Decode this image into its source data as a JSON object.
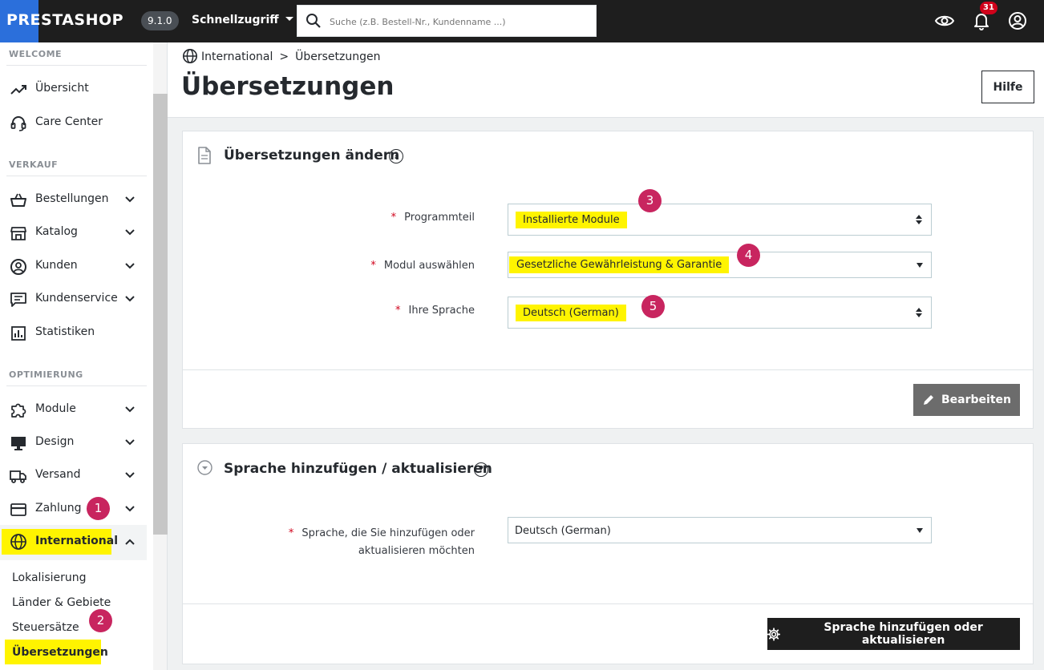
{
  "header": {
    "logo_text": "PRESTASHOP",
    "version": "9.1.0",
    "quick_access": "Schnellzugriff",
    "search_placeholder": "Suche (z.B. Bestell-Nr., Kundenname ...)",
    "notification_count": "31",
    "icons": [
      "eye-icon",
      "bell-icon",
      "account-icon"
    ]
  },
  "sidebar": {
    "sections": {
      "welcome": "WELCOME",
      "sales": "VERKAUF",
      "optimize": "OPTIMIERUNG"
    },
    "items": {
      "overview": "Übersicht",
      "care_center": "Care Center",
      "orders": "Bestellungen",
      "catalog": "Katalog",
      "customers": "Kunden",
      "customer_service": "Kundenservice",
      "stats": "Statistiken",
      "modules": "Module",
      "design": "Design",
      "shipping": "Versand",
      "payment": "Zahlung",
      "international": "International"
    },
    "subitems": {
      "localization": "Lokalisierung",
      "countries": "Länder & Gebiete",
      "taxes": "Steuersätze",
      "translations": "Übersetzungen"
    }
  },
  "annotations": [
    "1",
    "2",
    "3",
    "4",
    "5"
  ],
  "page": {
    "breadcrumb_parent": "International",
    "breadcrumb_sep": ">",
    "breadcrumb_current": "Übersetzungen",
    "title": "Übersetzungen",
    "help_button": "Hilfe"
  },
  "modify_card": {
    "title": "Übersetzungen ändern",
    "help": "?",
    "fields": {
      "type_label": "Programmteil",
      "type_value": "Installierte Module",
      "module_label": "Modul auswählen",
      "module_value": "Gesetzliche Gewährleistung & Garantie",
      "lang_label": "Ihre Sprache",
      "lang_value": "Deutsch (German)"
    },
    "required_mark": "*",
    "edit_button": "Bearbeiten"
  },
  "add_card": {
    "title": "Sprache hinzufügen / aktualisieren",
    "help": "?",
    "field_label_line1": "Sprache, die Sie hinzufügen oder",
    "field_label_line2": "aktualisieren möchten",
    "field_value": "Deutsch (German)",
    "required_mark": "*",
    "submit_button": "Sprache hinzufügen oder aktualisieren"
  },
  "colors": {
    "highlight": "#fff400",
    "step_badge": "#c8255f",
    "topbar": "#1e1e1e",
    "logo_bg": "#2b6fdb",
    "required": "#d0021b"
  }
}
